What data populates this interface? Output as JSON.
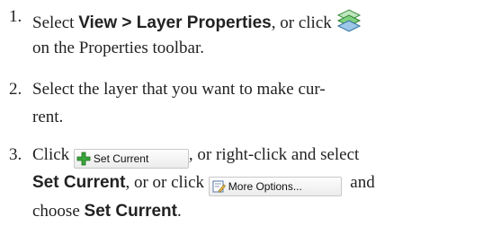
{
  "steps": [
    {
      "number": "1.",
      "line1_pre": "Select ",
      "line1_bold": "View > Layer Properties",
      "line1_post": ", or click",
      "line2": "on the Properties toolbar."
    },
    {
      "number": "2.",
      "line1": "Select the layer that you want to make cur-",
      "line2": "rent."
    },
    {
      "number": "3.",
      "line1_pre": "Click ",
      "line1_button": "Set Current",
      "line1_post": ", or right-click and select",
      "line2_bold": "Set Current",
      "line2_mid": ", or or click ",
      "line2_button": "More Options...",
      "line2_post": "and",
      "line3_pre": "choose ",
      "line3_bold": "Set Current",
      "line3_post": "."
    }
  ],
  "icons": {
    "layer_properties": "layer-stack-icon",
    "set_current": "green-plus-icon",
    "more_options": "edit-document-icon"
  }
}
